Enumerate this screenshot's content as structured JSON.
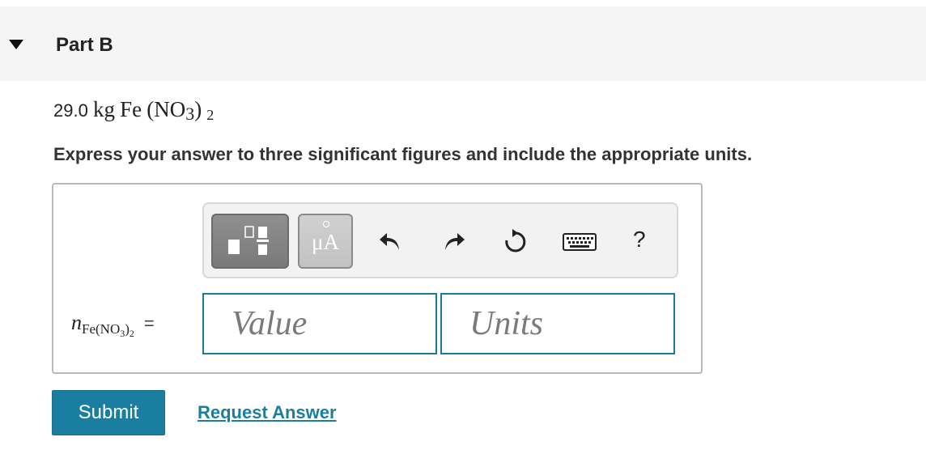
{
  "part": {
    "title": "Part B"
  },
  "question": {
    "mass": "29.0",
    "unit": "kg",
    "element": "Fe",
    "formula_open": "(NO",
    "formula_sub": "3",
    "formula_close": ")",
    "formula_index": "2",
    "instruction": "Express your answer to three significant figures and include the appropriate units."
  },
  "toolbar": {
    "template_icon": "fraction-template-icon",
    "units_label": "μA",
    "undo_icon": "undo-icon",
    "redo_icon": "redo-icon",
    "reset_icon": "reset-icon",
    "keyboard_icon": "keyboard-icon",
    "help_label": "?"
  },
  "answer": {
    "variable": "n",
    "variable_sub": "Fe(NO",
    "variable_sub_small": "3",
    "variable_sub_close": ")",
    "variable_sub_small2": "2",
    "equals": "=",
    "value_placeholder": "Value",
    "units_placeholder": "Units"
  },
  "actions": {
    "submit_label": "Submit",
    "request_label": "Request Answer"
  },
  "colors": {
    "accent": "#1a7ea0",
    "header_bg": "#f5f5f5"
  }
}
